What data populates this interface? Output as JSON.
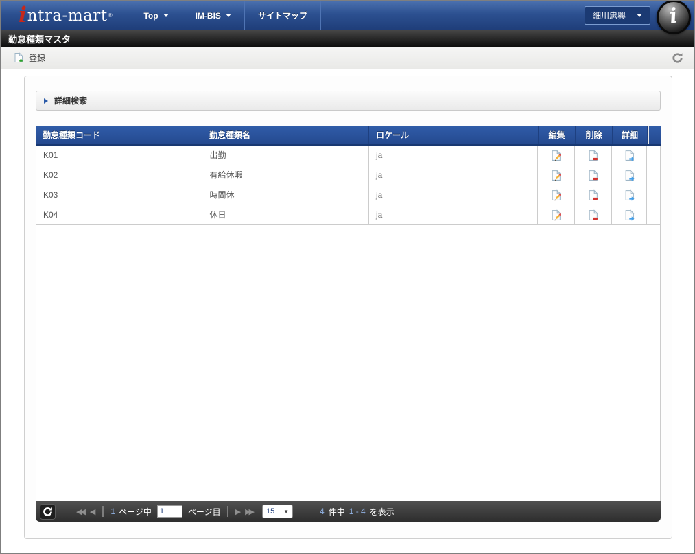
{
  "nav": {
    "logo": {
      "i": "i",
      "text": "ntra-mart",
      "reg": "®",
      "mark": "i"
    },
    "items": [
      {
        "label": "Top"
      },
      {
        "label": "IM-BIS"
      },
      {
        "label": "サイトマップ"
      }
    ],
    "user": {
      "name": "細川忠興"
    }
  },
  "title_bar": {
    "title": "勤怠種類マスタ"
  },
  "toolbar": {
    "register_label": "登録"
  },
  "search_panel": {
    "label": "詳細検索"
  },
  "table": {
    "columns": [
      "勤怠種類コード",
      "勤怠種類名",
      "ロケール",
      "編集",
      "削除",
      "詳細"
    ],
    "rows": [
      {
        "code": "K01",
        "name": "出勤",
        "locale": "ja"
      },
      {
        "code": "K02",
        "name": "有給休暇",
        "locale": "ja"
      },
      {
        "code": "K03",
        "name": "時間休",
        "locale": "ja"
      },
      {
        "code": "K04",
        "name": "休日",
        "locale": "ja"
      }
    ]
  },
  "pagination": {
    "first_icon": "◀◀",
    "prev_icon": "◀",
    "next_icon": "▶",
    "last_icon": "▶▶",
    "total_pages": "1",
    "pages_middle_label": "ページ中",
    "page_input_value": "1",
    "page_suffix_label": "ページ目",
    "page_size": "15",
    "select_arrow": "▼",
    "summary": {
      "total": "4",
      "of_label": "件中",
      "range": "1 - 4",
      "show_label": "を表示"
    }
  },
  "icons": {
    "register": "page-plus-icon",
    "edit": "page-pencil-icon",
    "delete": "page-minus-icon",
    "detail": "page-arrow-icon",
    "refresh": "circular-arrow-icon"
  },
  "colors": {
    "nav_blue": "#2c5090",
    "header_blue": "#2a549e",
    "brand_red": "#c6281c",
    "footer_dark": "#3a3a3a",
    "pagination_number_blue": "#8fb0e0",
    "edit_pencil": "#f2b33d",
    "delete_red": "#d23430",
    "detail_arrow_blue": "#44a0ea",
    "register_plus_green": "#2da12d"
  }
}
